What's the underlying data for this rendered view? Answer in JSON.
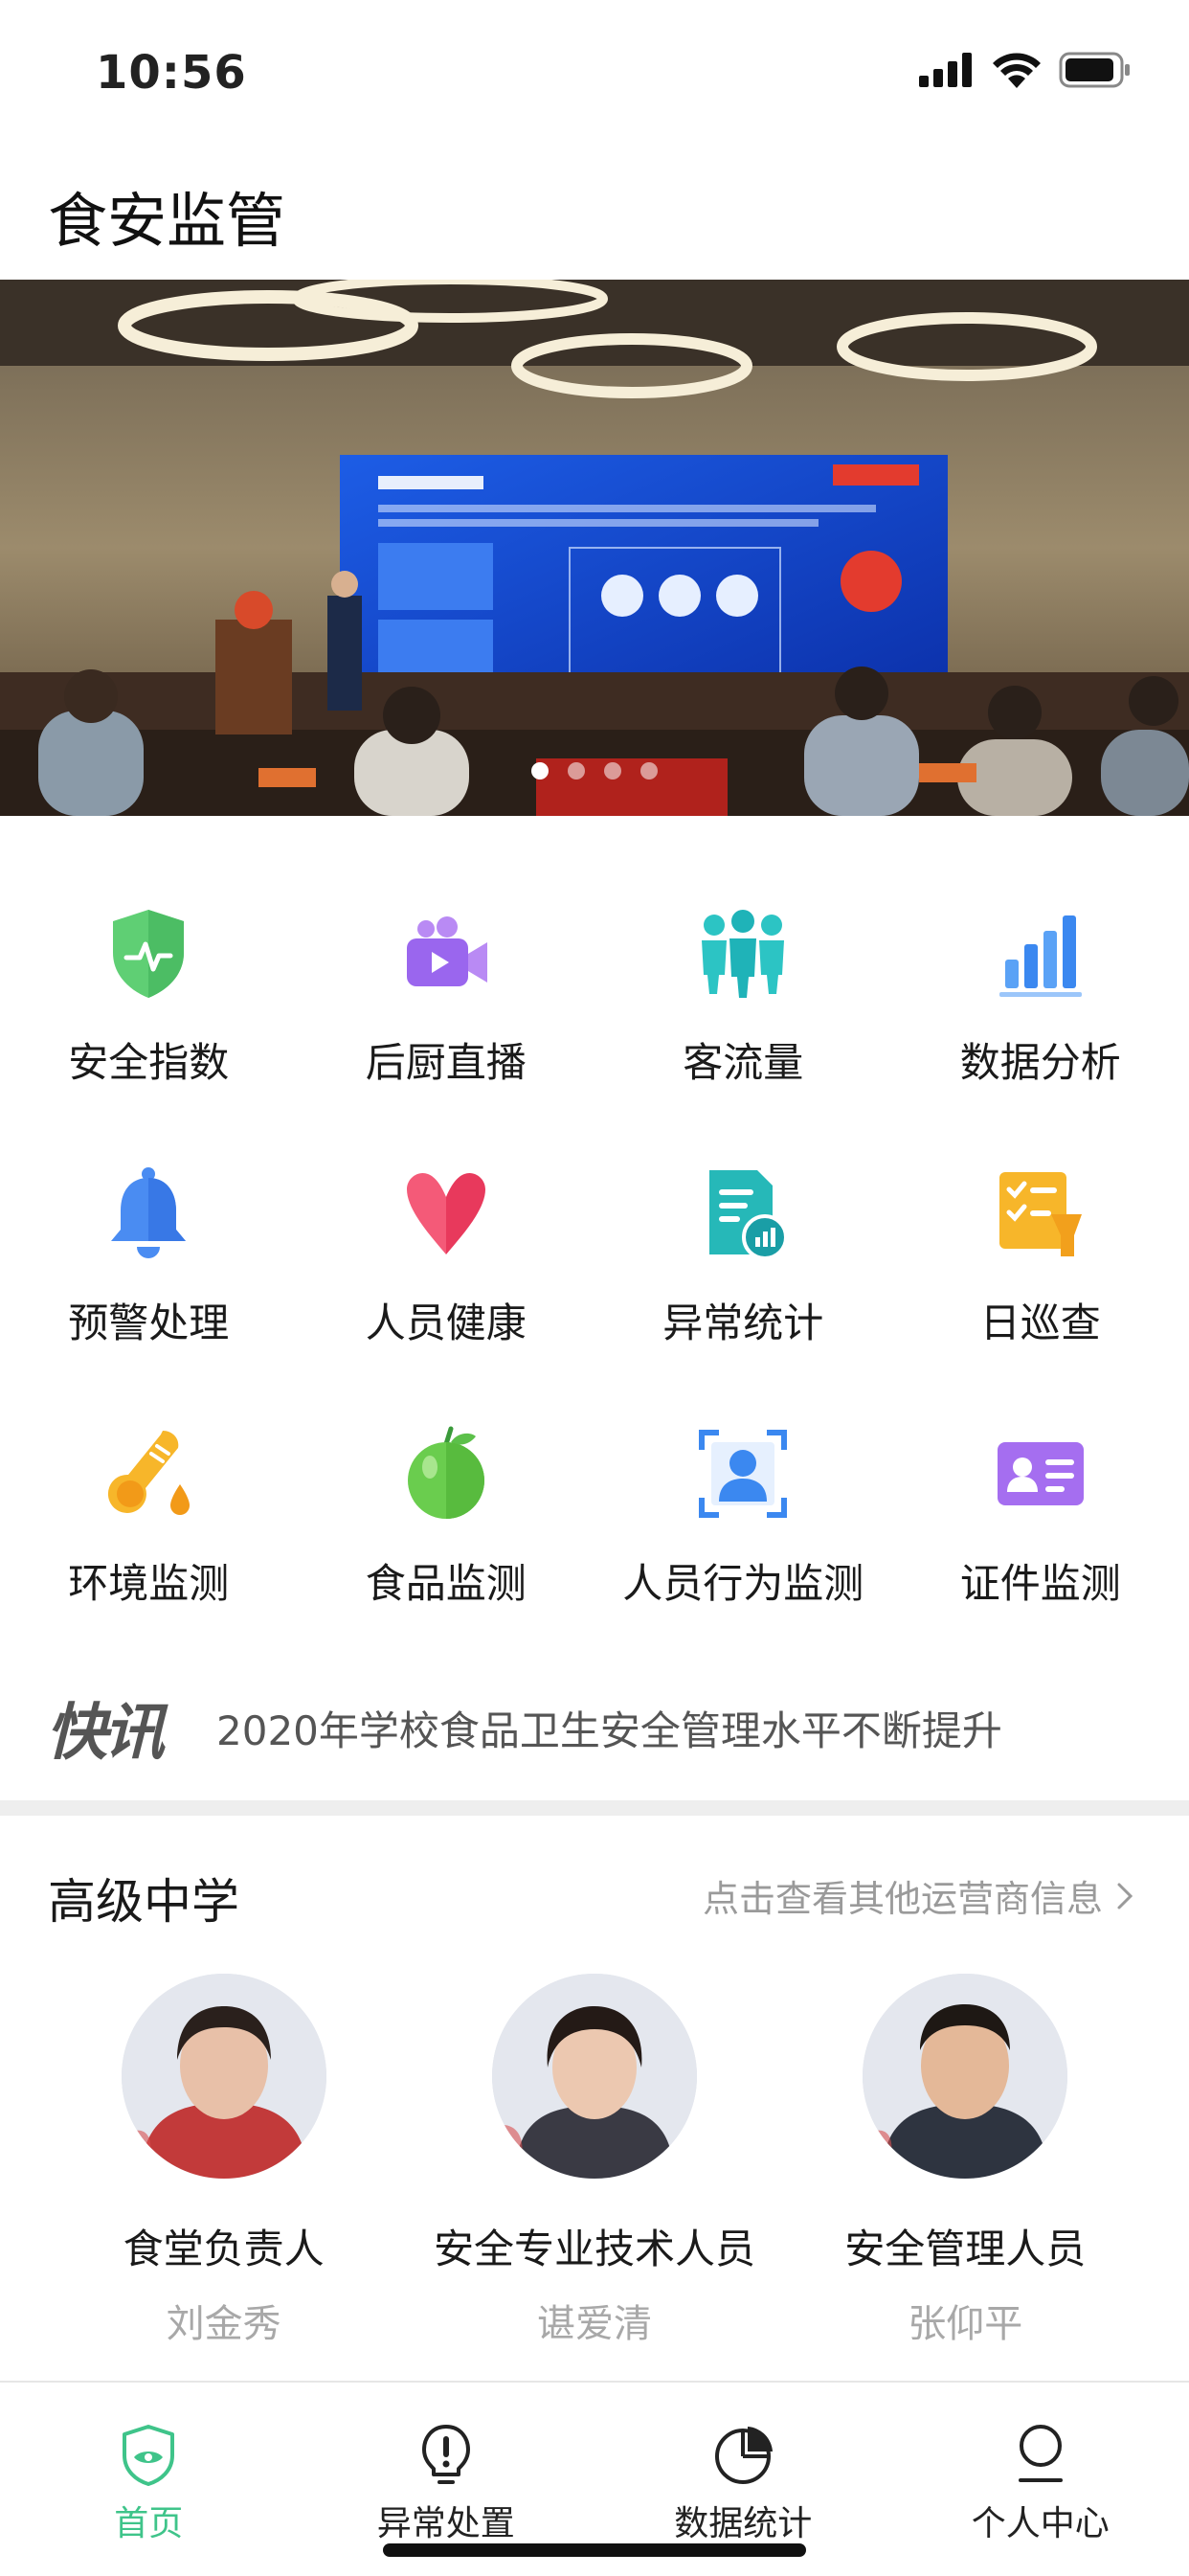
{
  "status": {
    "time": "10:56"
  },
  "app": {
    "title": "食安监管"
  },
  "banner": {
    "slide_count": 4,
    "active_slide": 1
  },
  "grid": [
    {
      "label": "安全指数",
      "icon": "shield-pulse-icon"
    },
    {
      "label": "后厨直播",
      "icon": "video-camera-icon"
    },
    {
      "label": "客流量",
      "icon": "people-group-icon"
    },
    {
      "label": "数据分析",
      "icon": "bar-chart-icon"
    },
    {
      "label": "预警处理",
      "icon": "bell-icon"
    },
    {
      "label": "人员健康",
      "icon": "heart-v-icon"
    },
    {
      "label": "异常统计",
      "icon": "report-chart-icon"
    },
    {
      "label": "日巡查",
      "icon": "checklist-icon"
    },
    {
      "label": "环境监测",
      "icon": "thermometer-icon"
    },
    {
      "label": "食品监测",
      "icon": "apple-icon"
    },
    {
      "label": "人员行为监测",
      "icon": "person-scan-icon"
    },
    {
      "label": "证件监测",
      "icon": "id-card-icon"
    }
  ],
  "news": {
    "logo": "快讯",
    "text": "2020年学校食品卫生安全管理水平不断提升"
  },
  "school": {
    "name": "高级中学",
    "link": "点击查看其他运营商信息",
    "people": [
      {
        "role": "食堂负责人",
        "name": "刘金秀"
      },
      {
        "role": "安全专业技术人员",
        "name": "谌爱清"
      },
      {
        "role": "安全管理人员",
        "name": "张仰平"
      }
    ]
  },
  "tabbar": [
    {
      "label": "首页",
      "icon": "shield-eye-icon",
      "active": true
    },
    {
      "label": "异常处置",
      "icon": "alert-bulb-icon",
      "active": false
    },
    {
      "label": "数据统计",
      "icon": "pie-chart-icon",
      "active": false
    },
    {
      "label": "个人中心",
      "icon": "user-icon",
      "active": false
    }
  ],
  "colors": {
    "accent": "#3fc48a",
    "text": "#1a1a1a",
    "muted": "#9a9a9a"
  }
}
